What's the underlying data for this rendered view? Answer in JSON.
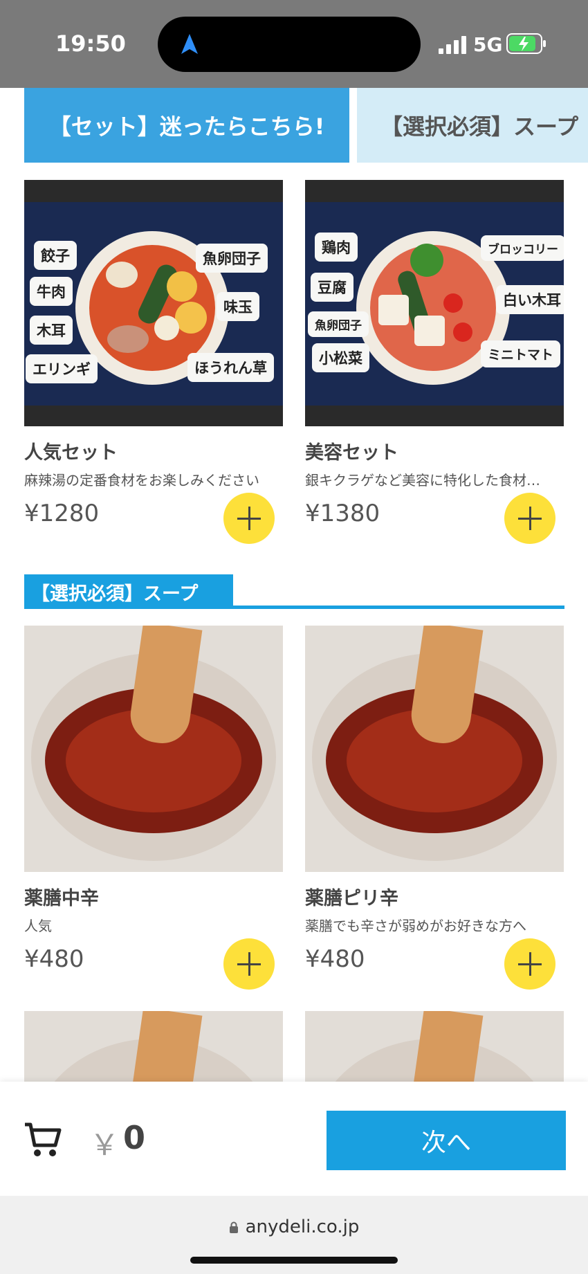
{
  "status_bar": {
    "time": "19:50",
    "network": "5G"
  },
  "tabs": [
    {
      "label": "【セット】迷ったらこちら!",
      "active": true
    },
    {
      "label": "【選択必須】スープ",
      "active": false
    }
  ],
  "sets": [
    {
      "name": "人気セット",
      "description": "麻辣湯の定番食材をお楽しみください",
      "price": "¥1280",
      "chips": [
        "餃子",
        "牛肉",
        "木耳",
        "エリンギ",
        "魚卵団子",
        "味玉",
        "ほうれん草"
      ]
    },
    {
      "name": "美容セット",
      "description": "銀キクラゲなど美容に特化した食材…",
      "price": "¥1380",
      "chips": [
        "鶏肉",
        "豆腐",
        "魚卵団子",
        "小松菜",
        "ブロッコリー",
        "白い木耳",
        "ミニトマト"
      ]
    }
  ],
  "soup_section": {
    "title": "【選択必須】スープ",
    "items": [
      {
        "name": "薬膳中辛",
        "description": "人気",
        "price": "¥480"
      },
      {
        "name": "薬膳ピリ辛",
        "description": "薬膳でも辛さが弱めがお好きな方へ",
        "price": "¥480"
      }
    ]
  },
  "cart": {
    "currency": "￥",
    "total": "0",
    "next_label": "次へ"
  },
  "browser": {
    "url": "anydeli.co.jp"
  },
  "colors": {
    "accent": "#19a0e0",
    "add_button": "#fde03a",
    "tab_inactive": "#d4ecf7"
  },
  "icons": [
    "navigation-arrow-icon",
    "signal-icon",
    "battery-charging-icon",
    "plus-icon",
    "cart-icon",
    "lock-icon"
  ]
}
